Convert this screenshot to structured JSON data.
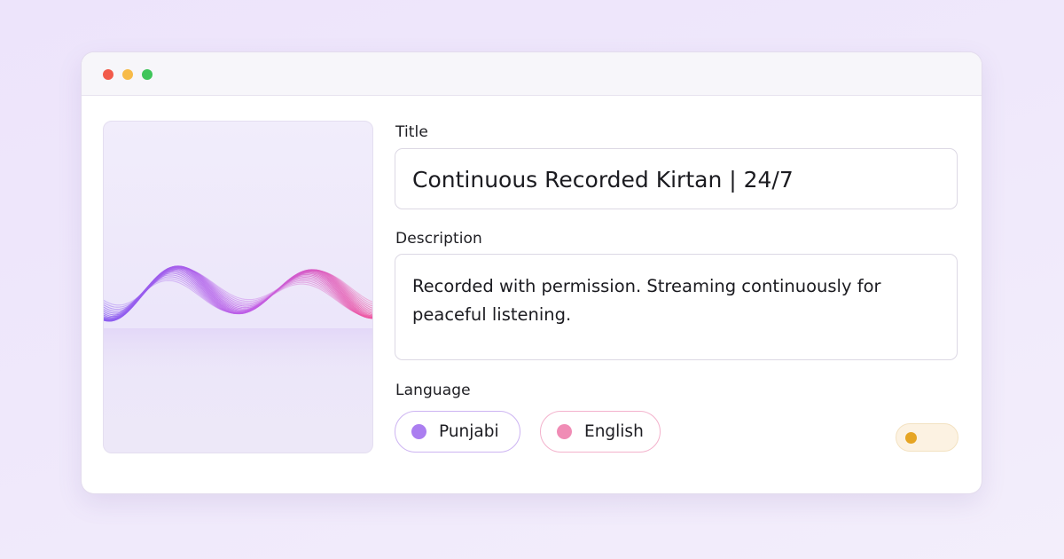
{
  "window": {
    "controls": [
      "close",
      "minimize",
      "maximize"
    ]
  },
  "artwork": {
    "description_icon": "sound-waveform-image",
    "colors": [
      "#8a5cf0",
      "#c05de6",
      "#f0559f"
    ]
  },
  "form": {
    "title_label": "Title",
    "title_value": "Continuous Recorded Kirtan | 24/7",
    "description_label": "Description",
    "description_value": "Recorded with permission. Streaming continuously for peaceful listening.",
    "language_label": "Language",
    "languages": [
      {
        "label": "Punjabi",
        "color": "#ab7ef0"
      },
      {
        "label": "English",
        "color": "#f08cb5"
      }
    ]
  },
  "toggle": {
    "state": "off",
    "color": "#e6a524"
  }
}
